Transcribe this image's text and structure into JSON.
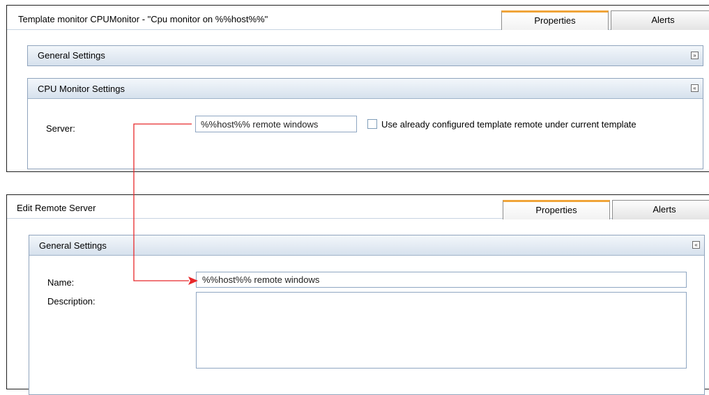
{
  "template_monitor": {
    "title": "Template monitor CPUMonitor - \"Cpu monitor on %%host%%\"",
    "tabs": [
      {
        "label": "Properties",
        "active": true
      },
      {
        "label": "Alerts",
        "active": false
      }
    ],
    "general_settings": {
      "label": "General Settings",
      "toggle_icon": "expand-icon",
      "toggle_glyph": "»"
    },
    "cpu_settings": {
      "label": "CPU Monitor Settings",
      "toggle_icon": "collapse-icon",
      "toggle_glyph": "«",
      "server_label": "Server:",
      "server_value": "%%host%% remote windows",
      "checkbox_label": "Use already configured template remote under current template",
      "checkbox_checked": false
    }
  },
  "edit_remote": {
    "title": "Edit Remote Server",
    "tabs": [
      {
        "label": "Properties",
        "active": true
      },
      {
        "label": "Alerts",
        "active": false
      }
    ],
    "general_settings": {
      "label": "General Settings",
      "toggle_icon": "collapse-icon",
      "toggle_glyph": "«",
      "name_label": "Name:",
      "name_value": "%%host%% remote windows",
      "description_label": "Description:",
      "description_value": ""
    }
  },
  "colors": {
    "connector_arrow": "#e8282b",
    "active_tab_accent": "#f0a439",
    "panel_header_top": "#f3f7fb",
    "panel_header_bottom": "#d6e1ed"
  }
}
